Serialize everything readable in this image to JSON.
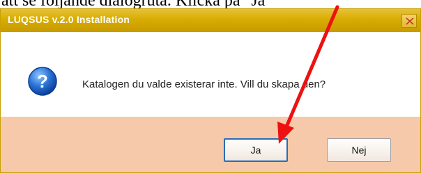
{
  "document": {
    "text_fragment": "att se följande dialogruta. Klicka på \"Ja\""
  },
  "dialog": {
    "title": "LUQSUS v.2.0 Installation",
    "message": "Katalogen du valde existerar inte. Vill du skapa den?",
    "icon": "question-icon",
    "buttons": {
      "yes_label": "Ja",
      "no_label": "Nej"
    }
  },
  "colors": {
    "titlebar": "#d8ad00",
    "button_bar": "#f5c9a9",
    "annotation_arrow": "#ee1111"
  }
}
